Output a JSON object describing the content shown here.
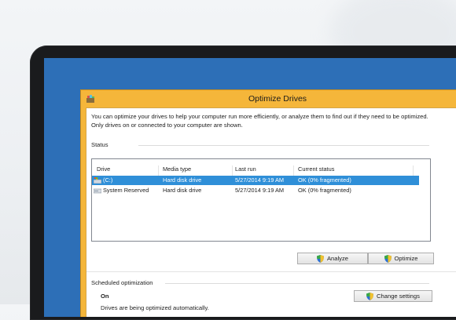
{
  "window": {
    "title": "Optimize Drives"
  },
  "description": "You can optimize your drives to help your computer run more efficiently, or analyze them to find out if they need to be optimized. Only drives on or connected to your computer are shown.",
  "status": {
    "label": "Status",
    "columns": [
      "Drive",
      "Media type",
      "Last run",
      "Current status"
    ],
    "rows": [
      {
        "drive": "(C:)",
        "media": "Hard disk drive",
        "last_run": "5/27/2014 9:19 AM",
        "status": "OK (0% fragmented)",
        "selected": true,
        "icon": "hard-drive-windows-icon"
      },
      {
        "drive": "System Reserved",
        "media": "Hard disk drive",
        "last_run": "5/27/2014 9:19 AM",
        "status": "OK (0% fragmented)",
        "selected": false,
        "icon": "hard-drive-icon"
      }
    ]
  },
  "buttons": {
    "analyze": "Analyze",
    "optimize": "Optimize",
    "change_settings": "Change settings"
  },
  "scheduled": {
    "label": "Scheduled optimization",
    "state": "On",
    "detail": "Drives are being optimized automatically."
  },
  "colors": {
    "window_frame": "#f5b63a",
    "selection": "#2f8fd8",
    "desktop": "#2d6fb7"
  }
}
